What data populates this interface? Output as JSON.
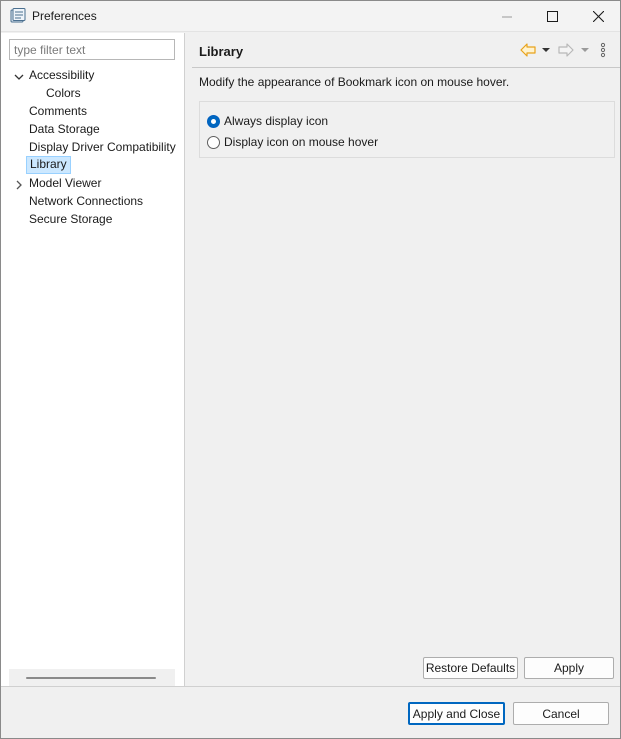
{
  "window": {
    "title": "Preferences",
    "icons": {
      "app": "preferences-app-icon",
      "minimize": "minimize-icon",
      "maximize": "maximize-icon",
      "close": "close-icon"
    }
  },
  "filter": {
    "placeholder": "type filter text",
    "value": ""
  },
  "tree": {
    "items": [
      {
        "label": "Accessibility",
        "expanded": true
      },
      {
        "label": "Colors"
      },
      {
        "label": "Comments"
      },
      {
        "label": "Data Storage"
      },
      {
        "label": "Display Driver Compatibility"
      },
      {
        "label": "Library",
        "selected": true
      },
      {
        "label": "Model Viewer",
        "expandable": true
      },
      {
        "label": "Network Connections"
      },
      {
        "label": "Secure Storage"
      }
    ]
  },
  "page": {
    "title": "Library",
    "description": "Modify the appearance of Bookmark icon on mouse hover.",
    "options": [
      {
        "label": "Always display icon",
        "checked": true
      },
      {
        "label": "Display icon on mouse hover",
        "checked": false
      }
    ],
    "restore_defaults": "Restore Defaults",
    "apply": "Apply"
  },
  "footer": {
    "apply_and_close": "Apply and Close",
    "cancel": "Cancel"
  },
  "colors": {
    "accent": "#0067c0",
    "selection_bg": "#cce8ff",
    "back_arrow": "#e8a21a"
  }
}
